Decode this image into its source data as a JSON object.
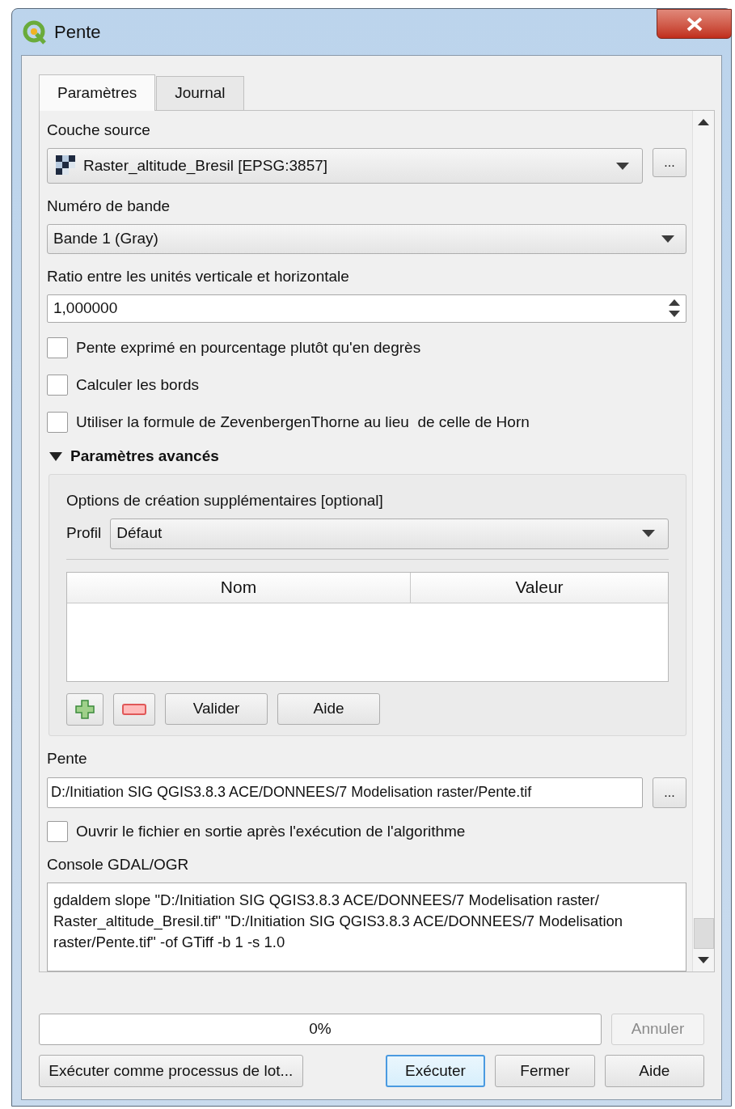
{
  "window": {
    "title": "Pente"
  },
  "tabs": [
    {
      "label": "Paramètres",
      "selected": true
    },
    {
      "label": "Journal",
      "selected": false
    }
  ],
  "source_layer": {
    "label": "Couche source",
    "value": "Raster_altitude_Bresil [EPSG:3857]",
    "browse": "..."
  },
  "band": {
    "label": "Numéro de bande",
    "value": "Bande 1 (Gray)"
  },
  "ratio": {
    "label": "Ratio entre les unités verticale et horizontale",
    "value": "1,000000"
  },
  "options": [
    {
      "label": "Pente exprimé en pourcentage plutôt qu'en degrès",
      "checked": false
    },
    {
      "label": "Calculer les bords",
      "checked": false
    },
    {
      "label": "Utiliser la formule de ZevenbergenThorne au lieu  de celle de Horn",
      "checked": false
    }
  ],
  "advanced": {
    "label": "Paramètres avancés",
    "expanded": true,
    "creation_options_label": "Options de création supplémentaires [optional]",
    "profile_label": "Profil",
    "profile": "Défaut",
    "columns": [
      "Nom",
      "Valeur"
    ],
    "buttons": [
      "Valider",
      "Aide"
    ]
  },
  "output": {
    "label": "Pente",
    "value": "D:/Initiation SIG QGIS3.8.3 ACE/DONNEES/7 Modelisation raster/Pente.tif",
    "browse": "..."
  },
  "open_output": {
    "label": "Ouvrir le fichier en sortie après l'exécution de l'algorithme",
    "checked": false
  },
  "console": {
    "label": "Console GDAL/OGR",
    "text": "gdaldem slope \"D:/Initiation SIG QGIS3.8.3 ACE/DONNEES/7 Modelisation raster/ Raster_altitude_Bresil.tif\" \"D:/Initiation SIG QGIS3.8.3 ACE/DONNEES/7 Modelisation raster/Pente.tif\" -of GTiff -b 1 -s 1.0"
  },
  "progress": {
    "level": 0,
    "reading": "0%"
  },
  "cancel": {
    "label": "Annuler",
    "disabled": true
  },
  "footer_buttons": [
    {
      "label": "Exécuter comme processus de lot...",
      "default": false
    },
    {
      "label": "Exécuter",
      "default": true
    },
    {
      "label": "Fermer",
      "default": false
    },
    {
      "label": "Aide",
      "default": false
    }
  ]
}
